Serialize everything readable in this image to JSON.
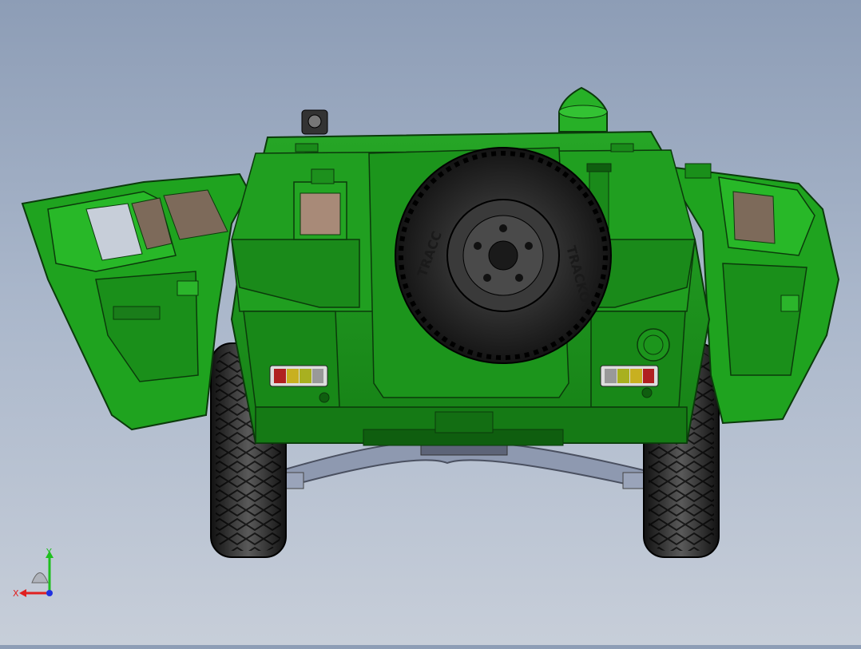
{
  "viewport": {
    "background_top": "#8d9db6",
    "background_bottom": "#c7ced9"
  },
  "model": {
    "body_color": "#1f9a1f",
    "body_dark": "#157a15",
    "body_light": "#36c236",
    "outline": "#0b3a0b",
    "tire_color": "#2a2a2a",
    "axle_color": "#8e99b0",
    "spare_tire_text_left": "TRACC",
    "spare_tire_text_right": "TRACKOT"
  },
  "triad": {
    "x_label": "X",
    "y_label": "Y",
    "x_color": "#e02020",
    "y_color": "#1fbf1f",
    "z_color": "#2030e0"
  }
}
